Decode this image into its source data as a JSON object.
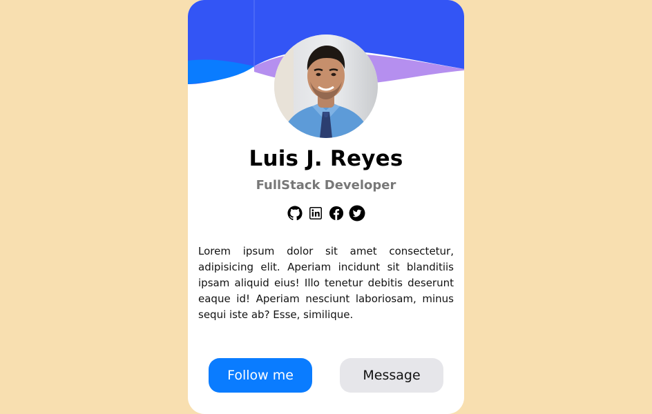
{
  "colors": {
    "page_background": "#f8dfb0",
    "card_background": "#ffffff",
    "header_blue": "#3355f5",
    "wave_blue": "#0a7cff",
    "wave_purple": "#b58fef",
    "primary_button": "#0a7cff",
    "secondary_button": "#e6e6ea",
    "role_text": "#777777"
  },
  "profile": {
    "name": "Luis J. Reyes",
    "role": "FullStack Developer",
    "avatar_alt": "Profile photo",
    "bio": "Lorem ipsum dolor sit amet consectetur, adipisicing elit. Aperiam incidunt sit blanditiis ipsam aliquid eius! Illo tenetur debitis deserunt eaque id! Aperiam nesciunt laboriosam, minus sequi iste ab? Esse, similique."
  },
  "socials": [
    {
      "icon": "github-icon"
    },
    {
      "icon": "linkedin-icon"
    },
    {
      "icon": "facebook-icon"
    },
    {
      "icon": "twitter-icon"
    }
  ],
  "actions": {
    "follow_label": "Follow me",
    "message_label": "Message"
  }
}
